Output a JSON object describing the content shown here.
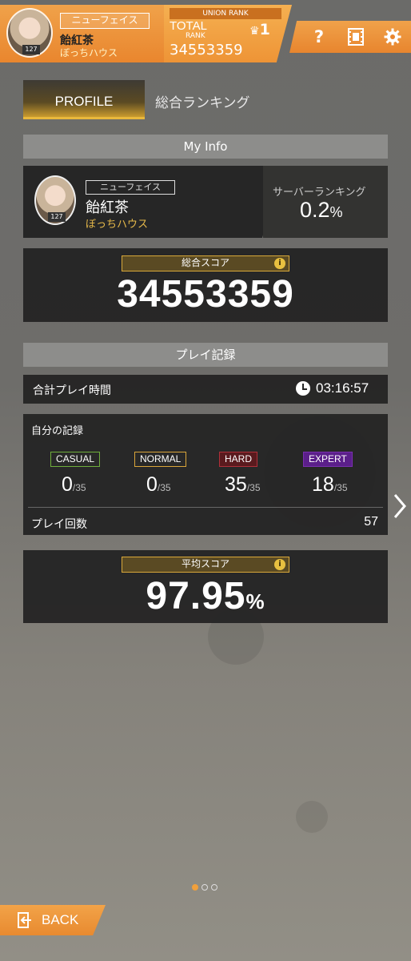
{
  "header": {
    "player_title": "ニューフェイス",
    "player_name": "飴紅茶",
    "guild": "ぼっちハウス",
    "level": "127",
    "union_rank_label": "UNION RANK",
    "total_label": "TOTAL",
    "rank_label": "RANK",
    "rank_value": "1",
    "total_score": "34553359",
    "icons": [
      "help-icon",
      "video-icon",
      "settings-icon"
    ],
    "help_glyph": "?"
  },
  "tabs": {
    "profile": "PROFILE",
    "ranking": "総合ランキング"
  },
  "my_info": {
    "heading": "My Info",
    "title": "ニューフェイス",
    "name": "飴紅茶",
    "guild": "ぼっちハウス",
    "level": "127",
    "server_ranking_label": "サーバーランキング",
    "server_ranking_value": "0.2",
    "server_ranking_unit": "%"
  },
  "total_score": {
    "label": "総合スコア",
    "value": "34553359",
    "info": "i"
  },
  "play_record": {
    "heading": "プレイ記録",
    "total_time_label": "合計プレイ時間",
    "total_time_value": "03:16:57",
    "my_records_label": "自分の記録",
    "difficulties": [
      {
        "name": "CASUAL",
        "cleared": "0",
        "total": "/35",
        "color": "#6fae3c"
      },
      {
        "name": "NORMAL",
        "cleared": "0",
        "total": "/35",
        "color": "#d9a53a"
      },
      {
        "name": "HARD",
        "cleared": "35",
        "total": "/35",
        "color": "#b0303a"
      },
      {
        "name": "EXPERT",
        "cleared": "18",
        "total": "/35",
        "color": "#7a2fb0"
      }
    ],
    "play_count_label": "プレイ回数",
    "play_count_value": "57"
  },
  "average_score": {
    "label": "平均スコア",
    "value": "97.95",
    "unit": "%",
    "info": "i"
  },
  "pagination": {
    "current": 1,
    "total": 3
  },
  "footer": {
    "back_label": "BACK"
  },
  "colors": {
    "accent": "#ee9436",
    "gold": "#d8a83a"
  }
}
